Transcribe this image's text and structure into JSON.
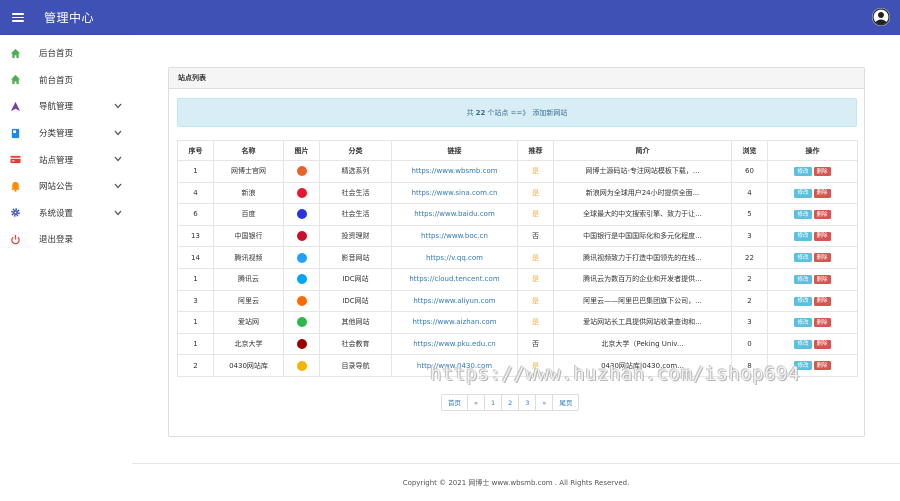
{
  "header": {
    "title": "管理中心"
  },
  "sidebar": {
    "items": [
      {
        "label": "后台首页",
        "color": "#4caf50"
      },
      {
        "label": "前台首页",
        "color": "#4caf50"
      },
      {
        "label": "导航管理",
        "color": "#7b3fa0"
      },
      {
        "label": "分类管理",
        "color": "#1e88e5"
      },
      {
        "label": "站点管理",
        "color": "#e53935"
      },
      {
        "label": "网站公告",
        "color": "#fb8c00"
      },
      {
        "label": "系统设置",
        "color": "#3f51b5"
      },
      {
        "label": "退出登录",
        "color": "#f44336"
      }
    ]
  },
  "card": {
    "title": "站点列表"
  },
  "info": {
    "prefix": "共",
    "count": "22",
    "suffix": "个站点 ==》",
    "add_link": "添加新网站"
  },
  "table": {
    "headers": [
      "序号",
      "名称",
      "图片",
      "分类",
      "链接",
      "推荐",
      "简介",
      "浏览",
      "操作"
    ],
    "edit_label": "修改",
    "delete_label": "删除",
    "rows": [
      {
        "id": "1",
        "name": "网博士官网",
        "icon_color": "#e8622c",
        "category": "精选系列",
        "link": "https://www.wbsmb.com",
        "recommend": "是",
        "intro": "网博士源码站-专注网站模板下载，...",
        "views": "60"
      },
      {
        "id": "4",
        "name": "新浪",
        "icon_color": "#e6162d",
        "category": "社会生活",
        "link": "https://www.sina.com.cn",
        "recommend": "是",
        "intro": "新浪网为全球用户24小时提供全面...",
        "views": "4"
      },
      {
        "id": "6",
        "name": "百度",
        "icon_color": "#2932e1",
        "category": "社会生活",
        "link": "https://www.baidu.com",
        "recommend": "是",
        "intro": "全球最大的中文搜索引擎、致力于让...",
        "views": "5"
      },
      {
        "id": "13",
        "name": "中国银行",
        "icon_color": "#c8102e",
        "category": "投资理财",
        "link": "https://www.boc.cn",
        "recommend": "否",
        "intro": "中国银行是中国国际化和多元化程度...",
        "views": "3"
      },
      {
        "id": "14",
        "name": "腾讯视频",
        "icon_color": "#20a0ff",
        "category": "影音网站",
        "link": "https://v.qq.com",
        "recommend": "是",
        "intro": "腾讯视频致力于打造中国领先的在线...",
        "views": "22"
      },
      {
        "id": "1",
        "name": "腾讯云",
        "icon_color": "#00a3ff",
        "category": "IDC网站",
        "link": "https://cloud.tencent.com",
        "recommend": "是",
        "intro": "腾讯云为数百万的企业和开发者提供...",
        "views": "2"
      },
      {
        "id": "3",
        "name": "阿里云",
        "icon_color": "#ff6a00",
        "category": "IDC网站",
        "link": "https://www.aliyun.com",
        "recommend": "是",
        "intro": "阿里云——阿里巴巴集团旗下公司，...",
        "views": "2"
      },
      {
        "id": "1",
        "name": "爱站网",
        "icon_color": "#2db84d",
        "category": "其他网站",
        "link": "https://www.aizhan.com",
        "recommend": "是",
        "intro": "爱站网站长工具提供网站收录查询和...",
        "views": "3"
      },
      {
        "id": "1",
        "name": "北京大学",
        "icon_color": "#9b0000",
        "category": "社会教育",
        "link": "https://www.pku.edu.cn",
        "recommend": "否",
        "intro": "北京大学（Peking Univ...",
        "views": "0"
      },
      {
        "id": "2",
        "name": "0430网站库",
        "icon_color": "#f4b400",
        "category": "目录导航",
        "link": "http://www.0430.com",
        "recommend": "是",
        "intro": "0430网站库|0430.com...",
        "views": "8"
      }
    ]
  },
  "pagination": [
    "首页",
    "«",
    "1",
    "2",
    "3",
    "»",
    "尾页"
  ],
  "watermark": "https://www.huzhan.com/ishop694",
  "footer": {
    "text": "Copyright © 2021 网博士 www.wbsmb.com . All Rights Reserved."
  }
}
